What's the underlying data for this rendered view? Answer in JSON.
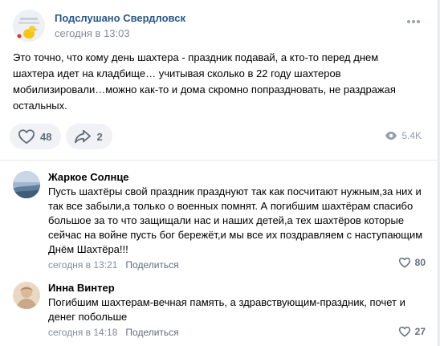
{
  "post": {
    "author": "Подслушано Свердловск",
    "time": "сегодня в 13:03",
    "avatar_icon": "community-logo-icon",
    "text": "Это точно, что кому день шахтера - праздник подавай, а кто-то перед днем шахтера идет на кладбище… учитывая сколько в 22 году шахтеров мобилизировали…можно как-то и дома скромно попраздновать, не раздражая остальных.",
    "likes": "48",
    "shares": "2",
    "views": "5.4K"
  },
  "colors": {
    "link": "#2a5885",
    "secondary": "#818c99",
    "button_bg": "#f0f2f5"
  },
  "comments": [
    {
      "author": "Жаркое Солнце",
      "text": "Пусть шахтёры свой праздник празднуют так как посчитают нужным,за них и так все забыли,а только о военных помнят. А погибшим шахтёрам спасибо большое за то что защищали нас и наших детей,а тех шахтёров которые сейчас на войне пусть бог бережёт,и мы все их поздравляем с наступающим Днём Шахтёра!!!",
      "time": "сегодня в 13:21",
      "reply": "Поделиться",
      "likes": "80"
    },
    {
      "author": "Инна Винтер",
      "text": "Погибшим шахтерам-вечная память, а здравствующим-праздник, почет и денег побольше",
      "time": "сегодня в 14:18",
      "reply": "Поделиться",
      "likes": "27"
    }
  ]
}
